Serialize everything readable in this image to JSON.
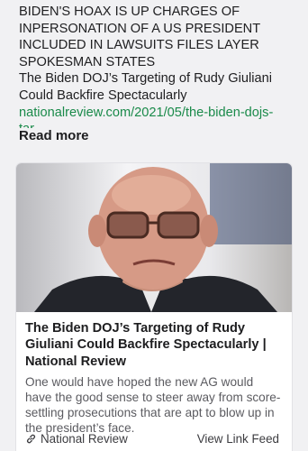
{
  "post": {
    "lines": [
      "BIDEN'S HOAX IS UP CHARGES OF",
      "INPERSONATION OF A US PRESIDENT",
      "INCLUDED IN LAWSUITS FILES LAYER",
      "SPOKESMAN STATES",
      "The Biden DOJ’s Targeting of Rudy Giuliani",
      "Could Backfire Spectacularly"
    ],
    "link": "nationalreview.com/2021/05/the-biden-dojs-",
    "link_cut": "tar",
    "read_more": "Read more"
  },
  "card": {
    "image_icon": "photo-of-man-in-glasses",
    "title": "The Biden DOJ’s Targeting of Rudy Giuliani Could Backfire Spectacularly | National Review",
    "description": "One would have hoped the new AG would have the good sense to steer away from score-settling prosecutions that are apt to blow up in the president’s face.",
    "source": "National Review",
    "source_icon": "link-icon",
    "view_feed": "View Link Feed"
  },
  "colors": {
    "background": "#f1f1f3",
    "link": "#1a8a4a",
    "card": "#ffffff"
  }
}
